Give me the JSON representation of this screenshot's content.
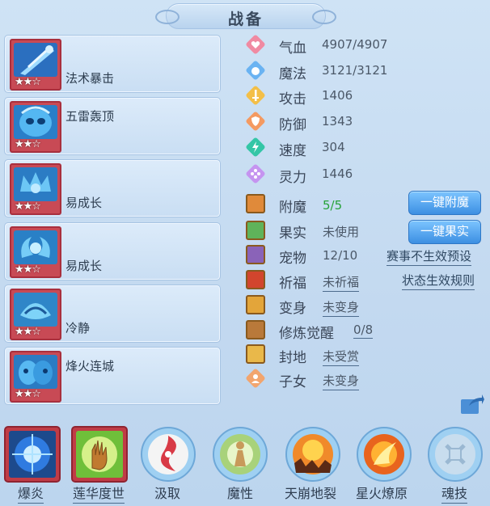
{
  "title": "战备",
  "skills": [
    {
      "name": "法术暴击",
      "stars": "★★☆",
      "icon": "crystal-spear-icon",
      "color": "#3c88d8"
    },
    {
      "name": "五雷轰顶",
      "stars": "★★☆",
      "icon": "blue-mask-icon",
      "color": "#3c9be0"
    },
    {
      "name": "易成长",
      "stars": "★★☆",
      "icon": "blue-crown-icon",
      "color": "#3aa3e6"
    },
    {
      "name": "易成长",
      "stars": "★★☆",
      "icon": "blue-claw-icon",
      "color": "#3aa3e6"
    },
    {
      "name": "冷静",
      "stars": "★★☆",
      "icon": "blue-helm-icon",
      "color": "#49a9e3"
    },
    {
      "name": "烽火连城",
      "stars": "★★☆",
      "icon": "blue-masks-icon",
      "color": "#3f98dc"
    }
  ],
  "stats": [
    {
      "label": "气血",
      "value": "4907/4907",
      "icon": "heart-icon",
      "color": "#ef6f8c"
    },
    {
      "label": "魔法",
      "value": "3121/3121",
      "icon": "mana-drop-icon",
      "color": "#5aa8ee"
    },
    {
      "label": "攻击",
      "value": "1406",
      "icon": "sword-icon",
      "color": "#f2b53b"
    },
    {
      "label": "防御",
      "value": "1343",
      "icon": "shield-icon",
      "color": "#f5945b"
    },
    {
      "label": "速度",
      "value": "304",
      "icon": "lightning-icon",
      "color": "#2fc9a5"
    },
    {
      "label": "灵力",
      "value": "1446",
      "icon": "spirit-diamond-icon",
      "color": "#c18ff2"
    }
  ],
  "extras": [
    {
      "label": "附魔",
      "value": "5/5",
      "icon": "enchant-icon",
      "value_color": "#27a23a",
      "underline": false
    },
    {
      "label": "果实",
      "value": "未使用",
      "icon": "fruit-icon",
      "underline": false
    },
    {
      "label": "宠物",
      "value": "12/10",
      "icon": "pet-icon",
      "underline": false
    },
    {
      "label": "祈福",
      "value": "未祈福",
      "icon": "blessing-icon",
      "underline": true
    },
    {
      "label": "变身",
      "value": "未变身",
      "icon": "transform-icon",
      "underline": true
    },
    {
      "label": "修炼觉醒",
      "value": "0/8",
      "icon": "awaken-icon",
      "underline": true
    },
    {
      "label": "封地",
      "value": "未受赏",
      "icon": "fief-icon",
      "underline": true
    },
    {
      "label": "子女",
      "value": "未变身",
      "icon": "child-icon",
      "underline": true
    }
  ],
  "buttons": {
    "one_click_enchant": "一键附魔",
    "one_click_fruit": "一键果实"
  },
  "links": {
    "event_preset": "赛事不生效预设",
    "status_rules": "状态生效规则"
  },
  "bottom_skills": [
    {
      "label": "爆炎",
      "icon": "blue-burst-icon",
      "frame": "square"
    },
    {
      "label": "莲华度世",
      "icon": "golden-hand-icon",
      "frame": "square"
    },
    {
      "label": "汲取",
      "icon": "red-swirl-icon",
      "frame": "round"
    },
    {
      "label": "魔性",
      "icon": "green-figure-icon",
      "frame": "round"
    },
    {
      "label": "天崩地裂",
      "icon": "fire-crack-icon",
      "frame": "round"
    },
    {
      "label": "星火燎原",
      "icon": "fire-orb-icon",
      "frame": "round"
    },
    {
      "label": "魂技",
      "icon": "empty-soul-icon",
      "frame": "round"
    }
  ]
}
